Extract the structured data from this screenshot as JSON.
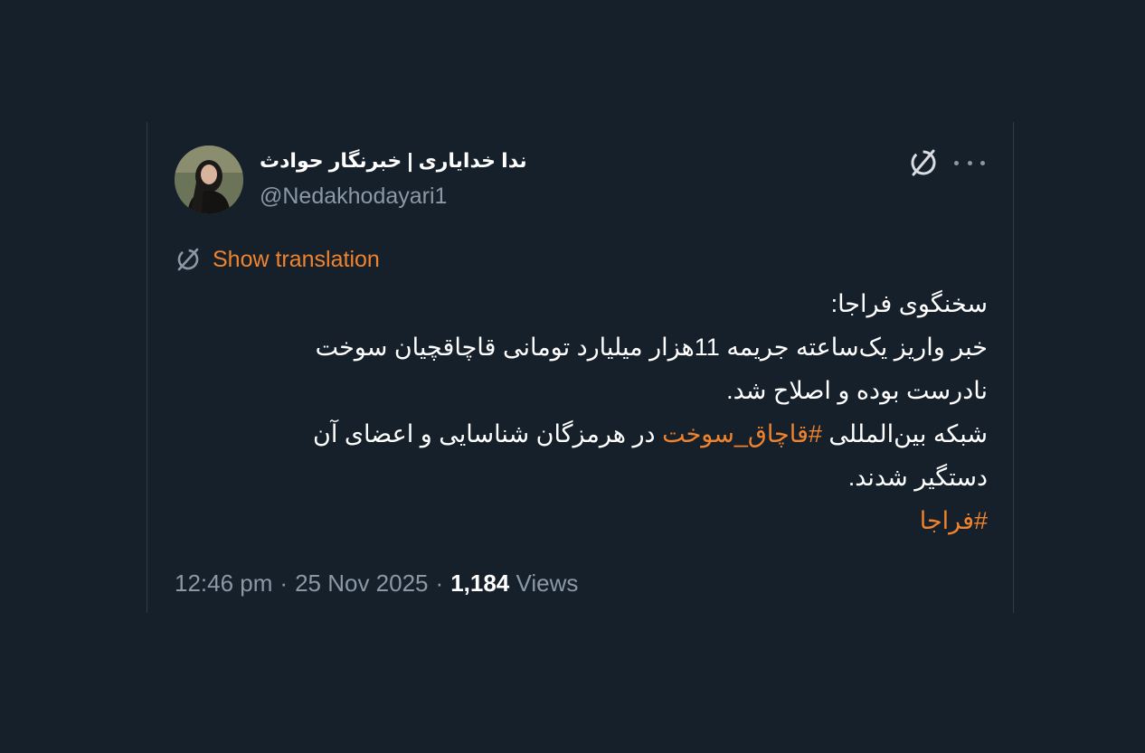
{
  "author": {
    "display_name": "ندا خدایاری | خبرنگار حوادث",
    "handle": "@Nedakhodayari1"
  },
  "icons": {
    "translate": "translate-icon",
    "more": "more-options-icon",
    "avatar": "profile-photo"
  },
  "translation": {
    "label": "Show translation"
  },
  "tweet": {
    "line1": "سخنگوی فراجا:",
    "line2": "خبر واریز یک‌ساعته جریمه 11هزار میلیارد تومانی قاچاقچیان سوخت",
    "line3": "نادرست بوده و اصلاح شد.",
    "line4_before": "شبکه بین‌المللی ",
    "line4_hashtag": "#قاچاق_سوخت",
    "line4_after": " در  هرمزگان شناسایی و اعضای آن",
    "line5": "دستگیر شدند.",
    "line6_hashtag": "#فراجا"
  },
  "meta": {
    "time": "12:46 pm",
    "separator": "·",
    "date": "25 Nov 2025",
    "views_count": "1,184",
    "views_label": "Views"
  },
  "colors": {
    "background": "#16202a",
    "accent": "#f0832e",
    "muted": "#8b98a5",
    "text": "#ffffff",
    "border": "#2f3b47"
  }
}
